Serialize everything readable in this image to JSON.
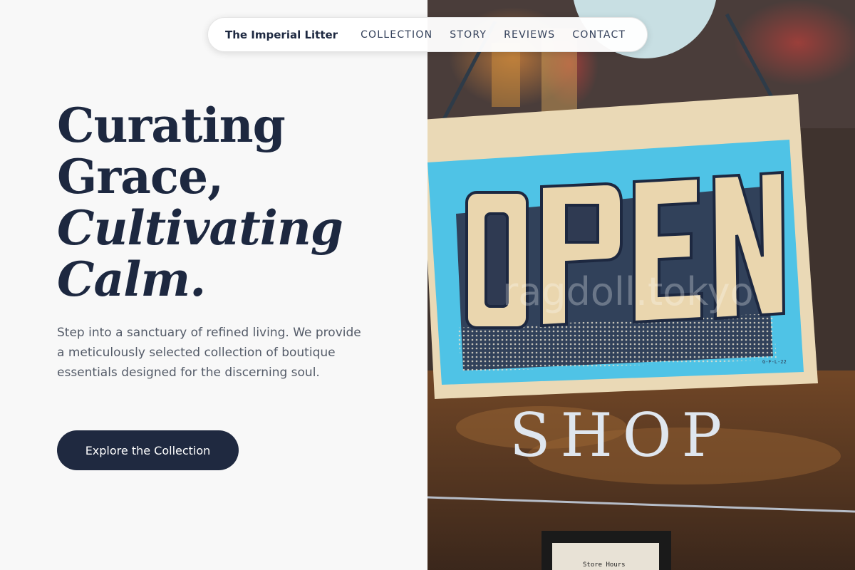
{
  "nav": {
    "brand": "The Imperial Litter",
    "links": [
      "COLLECTION",
      "STORY",
      "REVIEWS",
      "CONTACT"
    ]
  },
  "hero": {
    "headline": {
      "line1": "Curating",
      "line2": "Grace,",
      "line3": "Cultivating",
      "line4": "Calm."
    },
    "lede": "Step into a sanctuary of refined living. We provide a meticulously selected collection of boutique essentials designed for the discerning soul.",
    "cta_label": "Explore the Collection"
  },
  "photo": {
    "sign_text": "OPEN",
    "window_text": "SHOP",
    "watermark": "ragdoll.tokyo",
    "plaque_text": "Store Hours"
  },
  "colors": {
    "navy": "#1d2840",
    "text_muted": "#545b68",
    "sign_blue": "#4fc3e6",
    "sign_cream": "#ead9b6"
  }
}
